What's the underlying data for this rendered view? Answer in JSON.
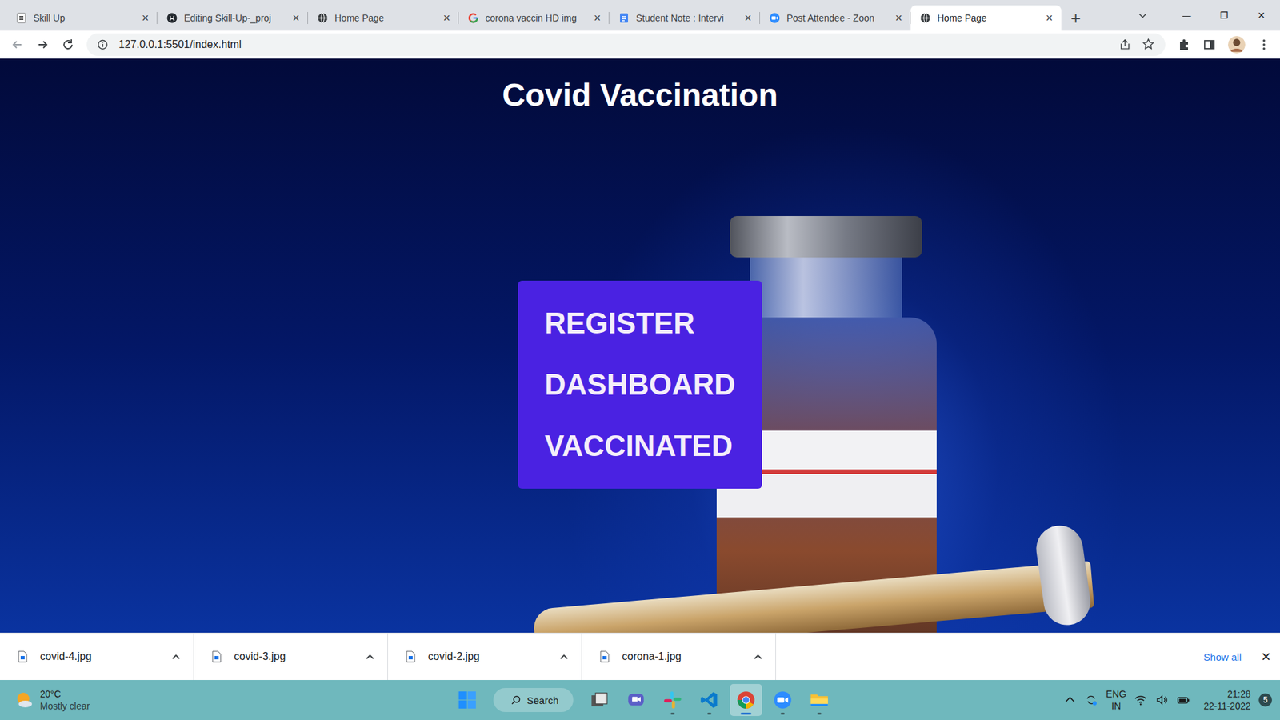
{
  "tabs": [
    {
      "label": "Skill Up",
      "selected": false,
      "kind": "skillup"
    },
    {
      "label": "Editing Skill-Up-_proj",
      "selected": false,
      "kind": "github"
    },
    {
      "label": "Home Page",
      "selected": false,
      "kind": "globe"
    },
    {
      "label": "corona vaccin HD img",
      "selected": false,
      "kind": "google"
    },
    {
      "label": "Student Note : Intervi",
      "selected": false,
      "kind": "docs"
    },
    {
      "label": "Post Attendee - Zoon",
      "selected": false,
      "kind": "zoom"
    },
    {
      "label": "Home Page",
      "selected": true,
      "kind": "globe"
    }
  ],
  "tab_close": "×",
  "new_tab": "+",
  "window_controls": [
    "—",
    "❐",
    "✕"
  ],
  "address": "127.0.0.1:5501/index.html",
  "page": {
    "title": "Covid Vaccination",
    "menu": [
      "REGISTER",
      "DASHBOARD",
      "VACCINATED"
    ]
  },
  "downloads": {
    "items": [
      "covid-4.jpg",
      "covid-3.jpg",
      "covid-2.jpg",
      "corona-1.jpg"
    ],
    "show_all": "Show all",
    "close": "×"
  },
  "taskbar": {
    "weather": {
      "temp": "20°C",
      "condition": "Mostly clear"
    },
    "search": "Search",
    "apps": [
      {
        "kind": "taskview",
        "running": false,
        "selected": false
      },
      {
        "kind": "chat",
        "running": false,
        "selected": false
      },
      {
        "kind": "slack",
        "running": true,
        "selected": false
      },
      {
        "kind": "vscode",
        "running": true,
        "selected": false
      },
      {
        "kind": "chrome",
        "running": true,
        "selected": true
      },
      {
        "kind": "zoom",
        "running": true,
        "selected": false
      },
      {
        "kind": "explorer",
        "running": true,
        "selected": false
      }
    ],
    "language": [
      "ENG",
      "IN"
    ],
    "time": "21:28",
    "date": "22-11-2022",
    "notifications": "5"
  }
}
